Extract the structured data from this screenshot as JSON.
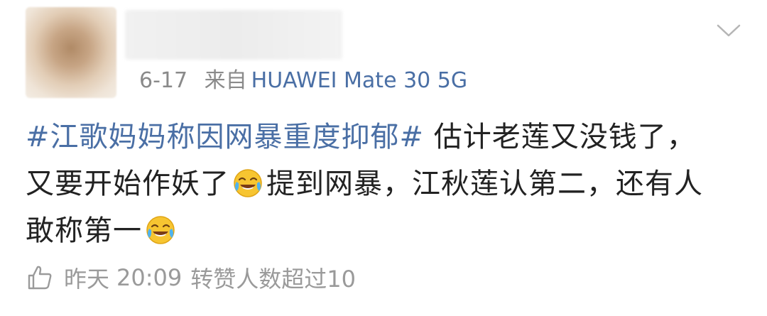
{
  "post": {
    "meta": {
      "date": "6-17",
      "source_prefix": "来自",
      "device": "HUAWEI Mate 30 5G"
    },
    "content": {
      "hashtag": "#江歌妈妈称因网暴重度抑郁#",
      "text_part1": "估计老莲又没钱了，又要开始作妖了",
      "text_part2": "提到网暴，江秋莲认第二，还有人敢称第一"
    },
    "footer": {
      "day": "昨天",
      "time": "20:09",
      "repost_text": "转赞人数超过10"
    }
  },
  "icons": {
    "chevron": "chevron-down-icon",
    "emoji": "laughing-crying-emoji-icon",
    "like": "thumbs-up-icon"
  },
  "colors": {
    "link": "#4a6fa5",
    "text": "#222222",
    "meta": "#8a8a8a"
  }
}
